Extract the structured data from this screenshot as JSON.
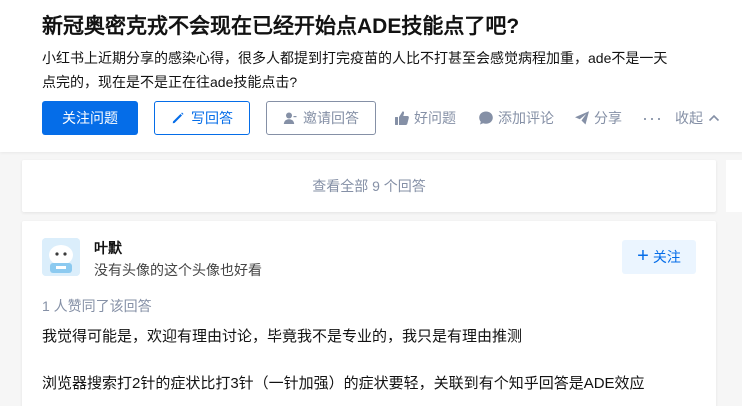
{
  "question": {
    "title": "新冠奥密克戎不会现在已经开始点ADE技能点了吧?",
    "description_line1": "小红书上近期分享的感染心得，很多人都提到打完疫苗的人比不打甚至会感觉病程加重，ade不是一天",
    "description_line2": "点完的，现在是不是正在往ade技能点击?"
  },
  "actions": {
    "follow_label": "关注问题",
    "answer_label": "写回答",
    "invite_label": "邀请回答",
    "good_question_label": "好问题",
    "comment_label": "添加评论",
    "share_label": "分享",
    "more_label": "···",
    "collapse_label": "收起"
  },
  "view_all": {
    "label": "查看全部 9 个回答"
  },
  "answer": {
    "author_name": "叶默",
    "author_bio": "没有头像的这个头像也好看",
    "follow_label": "关注",
    "voters": "1 人赞同了该回答",
    "paragraphs": [
      "我觉得可能是，欢迎有理由讨论，毕竟我不是专业的，我只是有理由推测",
      "浏览器搜索打2针的症状比打3针（一针加强）的症状要轻，关联到有个知乎回答是ADE效应"
    ]
  },
  "colors": {
    "brand_blue": "#056de8",
    "meta_gray": "#8590a6",
    "page_background": "#f6f6f6"
  }
}
